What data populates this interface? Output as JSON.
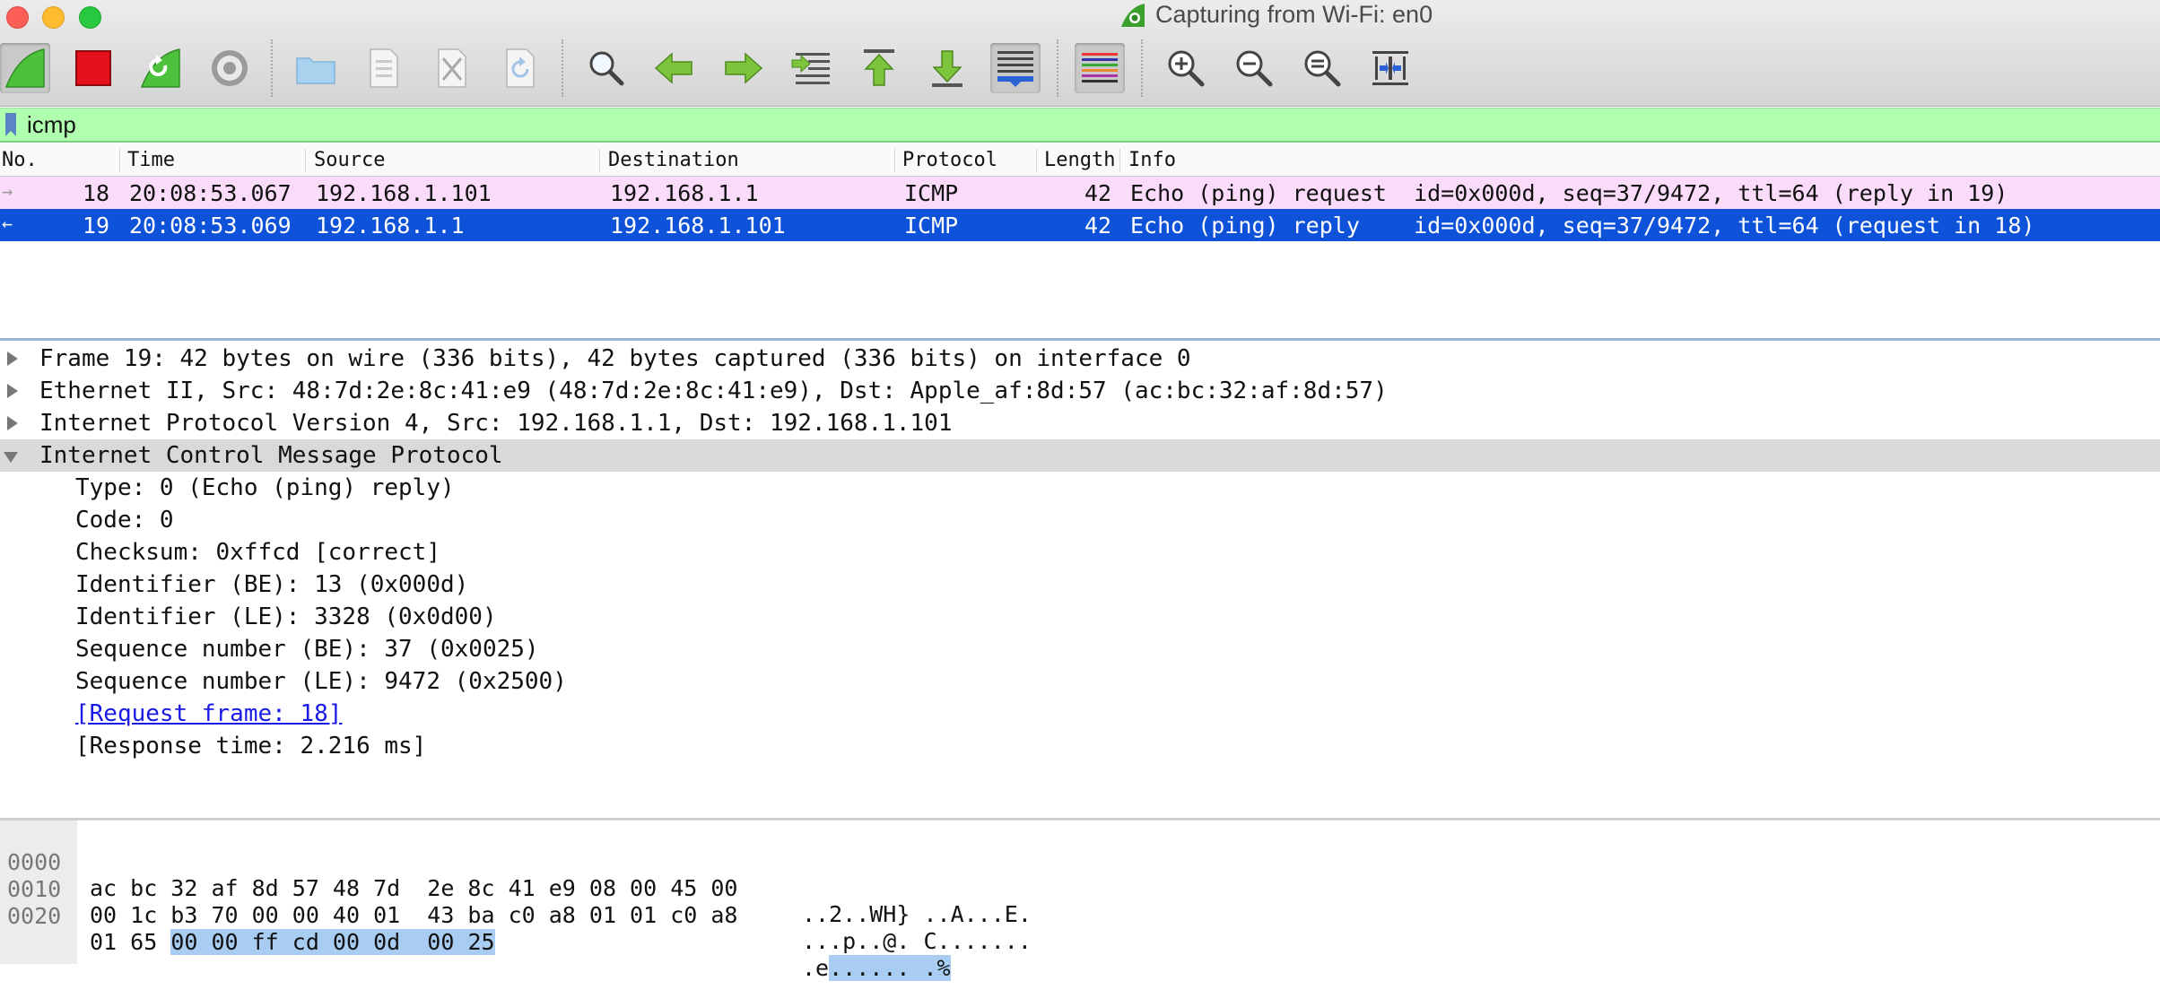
{
  "window": {
    "title": "Capturing from Wi-Fi: en0"
  },
  "toolbar": {
    "buttons": [
      {
        "name": "start-capture-icon"
      },
      {
        "name": "stop-capture-icon"
      },
      {
        "name": "restart-capture-icon"
      },
      {
        "name": "capture-options-icon"
      },
      {
        "name": "open-file-icon"
      },
      {
        "name": "save-file-icon"
      },
      {
        "name": "close-file-icon"
      },
      {
        "name": "reload-file-icon"
      },
      {
        "name": "find-packet-icon"
      },
      {
        "name": "go-back-icon"
      },
      {
        "name": "go-forward-icon"
      },
      {
        "name": "go-to-packet-icon"
      },
      {
        "name": "go-first-packet-icon"
      },
      {
        "name": "go-last-packet-icon"
      },
      {
        "name": "autoscroll-icon"
      },
      {
        "name": "colorize-icon"
      },
      {
        "name": "zoom-in-icon"
      },
      {
        "name": "zoom-out-icon"
      },
      {
        "name": "normal-size-icon"
      },
      {
        "name": "resize-columns-icon"
      }
    ]
  },
  "filter": {
    "value": "icmp"
  },
  "packet_list": {
    "columns": [
      "No.",
      "Time",
      "Source",
      "Destination",
      "Protocol",
      "Length",
      "Info"
    ],
    "rows": [
      {
        "direction": "→",
        "no": "18",
        "time": "20:08:53.067",
        "source": "192.168.1.101",
        "destination": "192.168.1.1",
        "protocol": "ICMP",
        "length": "42",
        "info": "Echo (ping) request  id=0x000d, seq=37/9472, ttl=64 (reply in 19)",
        "selected": false
      },
      {
        "direction": "←",
        "no": "19",
        "time": "20:08:53.069",
        "source": "192.168.1.1",
        "destination": "192.168.1.101",
        "protocol": "ICMP",
        "length": "42",
        "info": "Echo (ping) reply    id=0x000d, seq=37/9472, ttl=64 (request in 18)",
        "selected": true
      }
    ]
  },
  "details": {
    "frame": "Frame 19: 42 bytes on wire (336 bits), 42 bytes captured (336 bits) on interface 0",
    "ethernet": "Ethernet II, Src: 48:7d:2e:8c:41:e9 (48:7d:2e:8c:41:e9), Dst: Apple_af:8d:57 (ac:bc:32:af:8d:57)",
    "ip": "Internet Protocol Version 4, Src: 192.168.1.1, Dst: 192.168.1.101",
    "icmp": "Internet Control Message Protocol",
    "icmp_fields": [
      "Type: 0 (Echo (ping) reply)",
      "Code: 0",
      "Checksum: 0xffcd [correct]",
      "Identifier (BE): 13 (0x000d)",
      "Identifier (LE): 3328 (0x0d00)",
      "Sequence number (BE): 37 (0x0025)",
      "Sequence number (LE): 9472 (0x2500)"
    ],
    "request_frame": "[Request frame: 18]",
    "response_time": "[Response time: 2.216 ms]"
  },
  "bytes": {
    "rows": [
      {
        "offset": "0000",
        "hex": "ac bc 32 af 8d 57 48 7d  2e 8c 41 e9 08 00 45 00",
        "hex_sel": "",
        "ascii": "..2..WH} ..A...E.",
        "ascii_sel": ""
      },
      {
        "offset": "0010",
        "hex": "00 1c b3 70 00 00 40 01  43 ba c0 a8 01 01 c0 a8",
        "hex_sel": "",
        "ascii": "...p..@. C.......",
        "ascii_sel": ""
      },
      {
        "offset": "0020",
        "hex": "01 65 ",
        "hex_sel": "00 00 ff cd 00 0d  00 25",
        "ascii": ".e",
        "ascii_sel": "...... .%"
      }
    ]
  },
  "colors": {
    "selected_row": "#0d52d9",
    "icmp_row": "#fadcfa",
    "filter_valid": "#afffaf",
    "byte_selection": "#a9cdf2"
  }
}
